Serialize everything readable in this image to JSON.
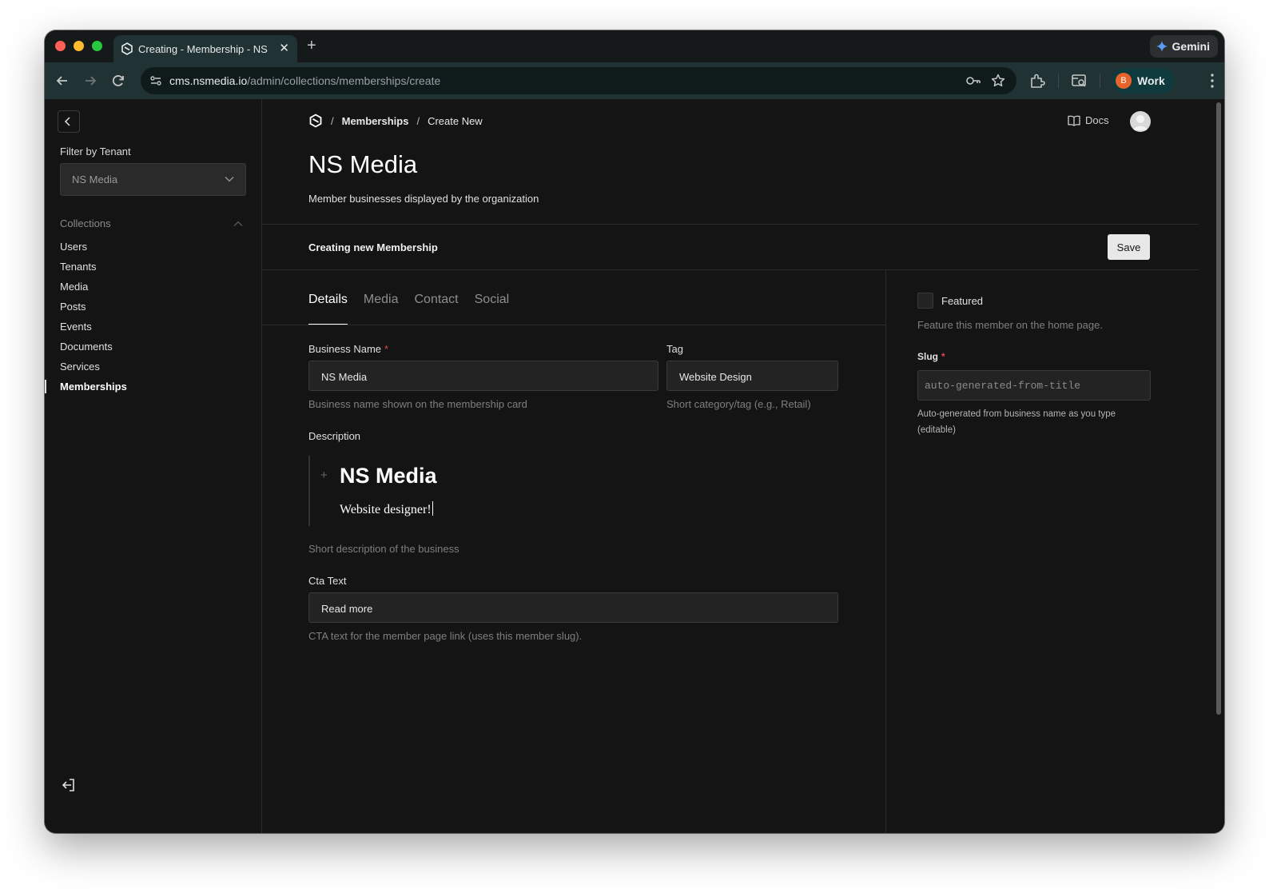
{
  "browser": {
    "tab_title": "Creating - Membership - NS M",
    "new_tab_label": "+",
    "close_label": "✕",
    "gemini_label": "Gemini",
    "url_host": "cms.nsmedia.io",
    "url_path": "/admin/collections/memberships/create",
    "profile_initial": "B",
    "profile_label": "Work"
  },
  "sidebar": {
    "filter_label": "Filter by Tenant",
    "tenant_value": "NS Media",
    "collections_label": "Collections",
    "items": [
      {
        "label": "Users"
      },
      {
        "label": "Tenants"
      },
      {
        "label": "Media"
      },
      {
        "label": "Posts"
      },
      {
        "label": "Events"
      },
      {
        "label": "Documents"
      },
      {
        "label": "Services"
      },
      {
        "label": "Memberships"
      }
    ],
    "active_item": "Memberships"
  },
  "header": {
    "breadcrumb_collection": "Memberships",
    "breadcrumb_current": "Create New",
    "breadcrumb_sep": "/",
    "docs_label": "Docs"
  },
  "page": {
    "title": "NS Media",
    "description": "Member businesses displayed by the organization",
    "status_label": "Creating new Membership",
    "save_label": "Save"
  },
  "tabs": [
    {
      "label": "Details",
      "active": true
    },
    {
      "label": "Media",
      "active": false
    },
    {
      "label": "Contact",
      "active": false
    },
    {
      "label": "Social",
      "active": false
    }
  ],
  "form": {
    "business_name": {
      "label": "Business Name",
      "required_mark": "*",
      "value": "NS Media",
      "hint": "Business name shown on the membership card"
    },
    "tag": {
      "label": "Tag",
      "value": "Website Design",
      "hint": "Short category/tag (e.g., Retail)"
    },
    "description": {
      "label": "Description",
      "heading": "NS Media",
      "paragraph": "Website designer!",
      "hint": "Short description of the business",
      "add_block_glyph": "+"
    },
    "cta_text": {
      "label": "Cta Text",
      "value": "Read more",
      "hint": "CTA text for the member page link (uses this member slug)."
    }
  },
  "side_panel": {
    "featured_label": "Featured",
    "featured_checked": false,
    "featured_hint": "Feature this member on the home page.",
    "slug_label": "Slug",
    "slug_required_mark": "*",
    "slug_placeholder": "auto-generated-from-title",
    "slug_hint_line1": "Auto-generated from business name as you type",
    "slug_hint_line2": "(editable)"
  },
  "colors": {
    "background": "#141414",
    "input_bg": "#232323",
    "required": "#e5484d",
    "chrome_toolbar": "#203233",
    "profile_avatar": "#e8632b"
  },
  "icons": [
    "back-arrow-icon",
    "forward-arrow-icon",
    "reload-icon",
    "site-settings-icon",
    "password-key-icon",
    "bookmark-star-icon",
    "extensions-icon",
    "tab-search-icon",
    "menu-kebab-icon",
    "gemini-sparkle-icon",
    "payload-logo-icon",
    "book-icon",
    "user-avatar-icon",
    "chevron-left-icon",
    "chevron-down-icon",
    "chevron-up-icon",
    "logout-icon"
  ]
}
